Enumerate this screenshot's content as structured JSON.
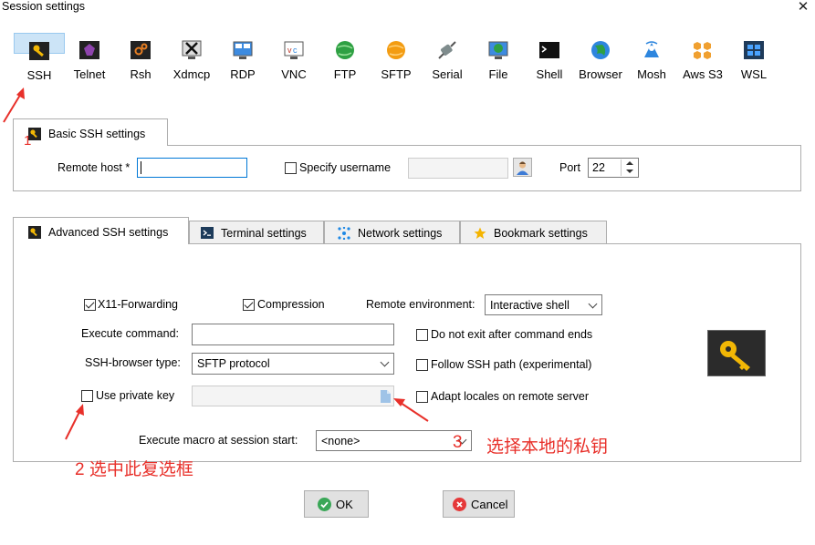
{
  "window": {
    "title": "Session settings",
    "close_glyph": "✕"
  },
  "toolbar": [
    {
      "label": "SSH",
      "icon": "ssh-icon",
      "selected": true
    },
    {
      "label": "Telnet",
      "icon": "telnet-icon"
    },
    {
      "label": "Rsh",
      "icon": "rsh-icon"
    },
    {
      "label": "Xdmcp",
      "icon": "xdmcp-icon"
    },
    {
      "label": "RDP",
      "icon": "rdp-icon"
    },
    {
      "label": "VNC",
      "icon": "vnc-icon"
    },
    {
      "label": "FTP",
      "icon": "ftp-icon"
    },
    {
      "label": "SFTP",
      "icon": "sftp-icon"
    },
    {
      "label": "Serial",
      "icon": "serial-icon"
    },
    {
      "label": "File",
      "icon": "file-icon"
    },
    {
      "label": "Shell",
      "icon": "shell-icon"
    },
    {
      "label": "Browser",
      "icon": "browser-icon"
    },
    {
      "label": "Mosh",
      "icon": "mosh-icon"
    },
    {
      "label": "Aws S3",
      "icon": "aws-s3-icon"
    },
    {
      "label": "WSL",
      "icon": "wsl-icon"
    }
  ],
  "basic": {
    "tab_label": "Basic SSH settings",
    "remote_host_label": "Remote host *",
    "remote_host_value": "",
    "specify_username_label": "Specify username",
    "specify_username_checked": false,
    "username_value": "",
    "port_label": "Port",
    "port_value": "22"
  },
  "advanced_tabs": [
    {
      "label": "Advanced SSH settings",
      "active": true
    },
    {
      "label": "Terminal settings"
    },
    {
      "label": "Network settings"
    },
    {
      "label": "Bookmark settings"
    }
  ],
  "advanced": {
    "x11_label": "X11-Forwarding",
    "x11_checked": true,
    "compression_label": "Compression",
    "compression_checked": true,
    "remote_env_label": "Remote environment:",
    "remote_env_value": "Interactive shell",
    "execute_command_label": "Execute command:",
    "execute_command_value": "",
    "do_not_exit_label": "Do not exit after command ends",
    "do_not_exit_checked": false,
    "ssh_browser_label": "SSH-browser type:",
    "ssh_browser_value": "SFTP protocol",
    "follow_ssh_label": "Follow SSH path (experimental)",
    "follow_ssh_checked": false,
    "use_private_key_label": "Use private key",
    "use_private_key_checked": false,
    "private_key_value": "",
    "adapt_locales_label": "Adapt locales on remote server",
    "adapt_locales_checked": false,
    "macro_label": "Execute macro at session start:",
    "macro_value": "<none>"
  },
  "buttons": {
    "ok": "OK",
    "cancel": "Cancel"
  },
  "annotations": {
    "step1": "1",
    "step2": "2 选中此复选框",
    "step3_num": "3",
    "step3_text": "选择本地的私钥",
    "color": "#e8302a"
  }
}
